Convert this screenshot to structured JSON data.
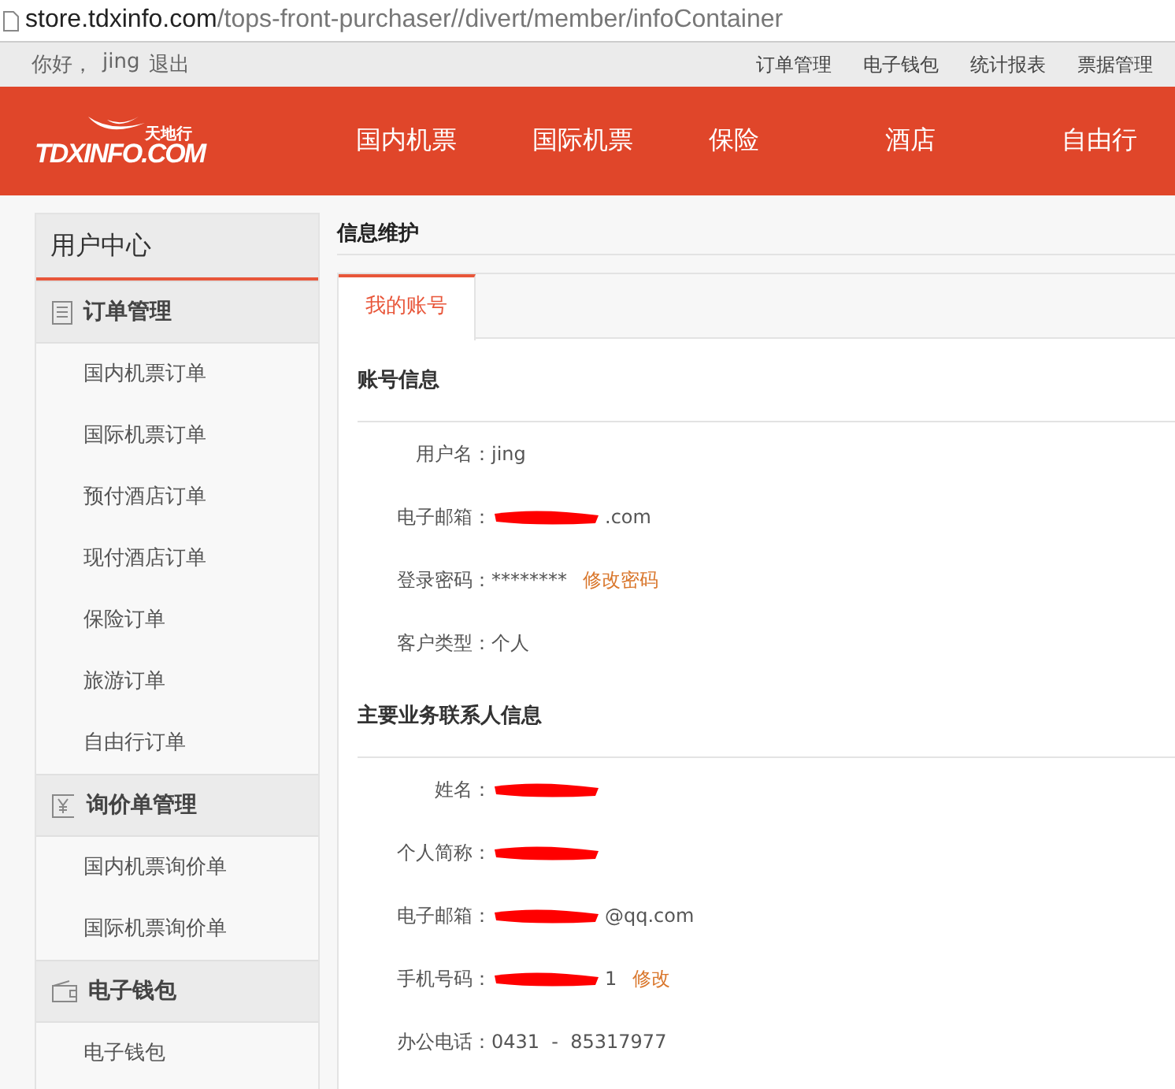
{
  "address_bar": {
    "url_host": "store.tdxinfo.com",
    "url_path": "/tops-front-purchaser//divert/member/infoContainer"
  },
  "top_bar": {
    "greeting": "你好，",
    "user": "jing",
    "logout": "退出",
    "links": [
      "订单管理",
      "电子钱包",
      "统计报表",
      "票据管理"
    ]
  },
  "header": {
    "logo_text": "TDXINFO.COM",
    "logo_cn": "天地行",
    "nav": [
      {
        "label": "国内机票",
        "selected": false
      },
      {
        "label": "国际机票",
        "selected": false
      },
      {
        "label": "保险",
        "selected": false
      },
      {
        "label": "酒店",
        "selected": false
      },
      {
        "label": "自由行",
        "selected": false
      }
    ]
  },
  "sidebar": {
    "title": "用户中心",
    "groups": [
      {
        "kind": "orders",
        "label": "订单管理",
        "items": [
          "国内机票订单",
          "国际机票订单",
          "预付酒店订单",
          "现付酒店订单",
          "保险订单",
          "旅游订单",
          "自由行订单"
        ]
      },
      {
        "kind": "inquiry",
        "label": "询价单管理",
        "items": [
          "国内机票询价单",
          "国际机票询价单"
        ]
      },
      {
        "kind": "wallet",
        "label": "电子钱包",
        "items": [
          "电子钱包"
        ]
      }
    ]
  },
  "content": {
    "title": "信息维护",
    "tabs": [
      {
        "label": "我的账号",
        "selected": true
      }
    ],
    "sections": [
      {
        "title": "账号信息",
        "fields": [
          {
            "label": "用户名：",
            "value": "jing"
          },
          {
            "label": "电子邮箱：",
            "value": ".com",
            "redacted": true
          },
          {
            "label": "登录密码：",
            "value": "********",
            "action": "修改密码"
          },
          {
            "label": "客户类型：",
            "value": "个人"
          }
        ]
      },
      {
        "title": "主要业务联系人信息",
        "fields": [
          {
            "label": "姓名：",
            "redacted": true
          },
          {
            "label": "个人简称：",
            "redacted": true
          },
          {
            "label": "电子邮箱：",
            "value": "@qq.com",
            "redacted": true
          },
          {
            "label": "手机号码：",
            "value": "1",
            "redacted": true,
            "action": "修改"
          },
          {
            "label": "办公电话：",
            "value": "0431  -  85317977"
          }
        ]
      }
    ]
  }
}
